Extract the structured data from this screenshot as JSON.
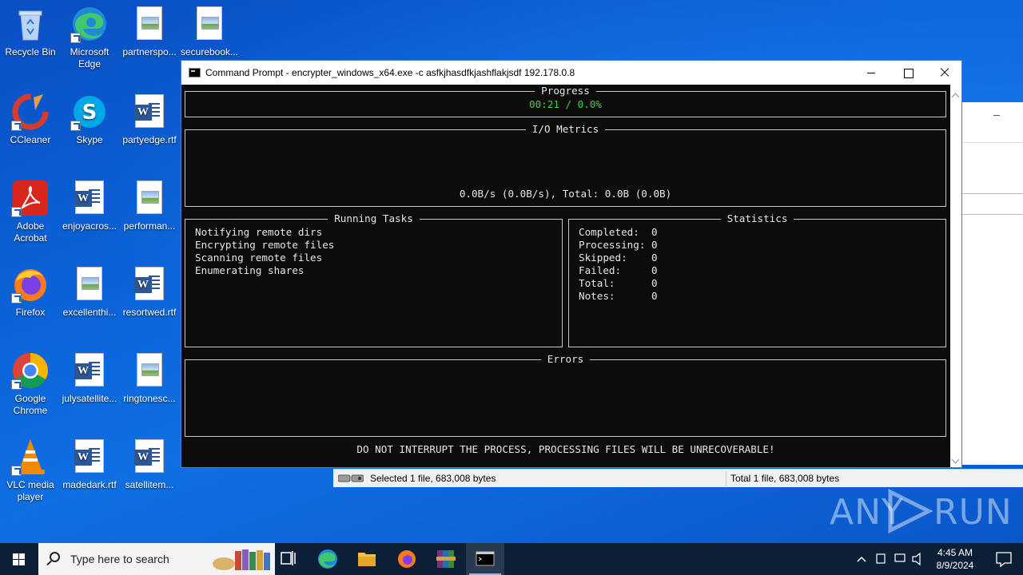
{
  "desktop": {
    "icons": [
      {
        "label": "Recycle Bin",
        "icon": "recycle-bin-icon"
      },
      {
        "label": "Microsoft Edge",
        "icon": "edge-icon"
      },
      {
        "label": "partnerspo...",
        "icon": "image-file-icon"
      },
      {
        "label": "securebook...",
        "icon": "image-file-icon"
      },
      {
        "label": "CCleaner",
        "icon": "ccleaner-icon"
      },
      {
        "label": "Skype",
        "icon": "skype-icon"
      },
      {
        "label": "partyedge.rtf",
        "icon": "word-file-icon"
      },
      {
        "label": "Adobe Acrobat",
        "icon": "acrobat-icon"
      },
      {
        "label": "enjoyacros...",
        "icon": "word-file-icon"
      },
      {
        "label": "performan...",
        "icon": "image-file-icon"
      },
      {
        "label": "Firefox",
        "icon": "firefox-icon"
      },
      {
        "label": "excellenthi...",
        "icon": "image-file-icon"
      },
      {
        "label": "resortwed.rtf",
        "icon": "word-file-icon"
      },
      {
        "label": "Google Chrome",
        "icon": "chrome-icon"
      },
      {
        "label": "julysatellite...",
        "icon": "word-file-icon"
      },
      {
        "label": "ringtonesc...",
        "icon": "image-file-icon"
      },
      {
        "label": "VLC media player",
        "icon": "vlc-icon"
      },
      {
        "label": "madedark.rtf",
        "icon": "word-file-icon"
      },
      {
        "label": "satellitem...",
        "icon": "word-file-icon"
      }
    ]
  },
  "explorer": {
    "status_selected": "Selected 1 file, 683,008 bytes",
    "status_total": "Total 1 file, 683,008 bytes"
  },
  "cmd": {
    "title": "Command Prompt - encrypter_windows_x64.exe  -c asfkjhasdfkjashflakjsdf 192.178.0.8",
    "progress_title": "Progress",
    "progress_value": "00:21 / 0.0%",
    "io_title": "I/O Metrics",
    "io_value": "0.0B/s (0.0B/s), Total: 0.0B (0.0B)",
    "tasks_title": "Running Tasks",
    "tasks": [
      "Notifying remote dirs",
      "Encrypting remote files",
      "Scanning remote files",
      "Enumerating shares"
    ],
    "stats_title": "Statistics",
    "stats": [
      "Completed:  0",
      "Processing: 0",
      "Skipped:    0",
      "Failed:     0",
      "Total:      0",
      "Notes:      0"
    ],
    "errors_title": "Errors",
    "warning": "DO NOT INTERRUPT THE PROCESS, PROCESSING FILES WILL BE UNRECOVERABLE!"
  },
  "watermark": {
    "left": "ANY",
    "right": "RUN"
  },
  "taskbar": {
    "search_placeholder": "Type here to search",
    "time": "4:45 AM",
    "date": "8/9/2024"
  },
  "colors": {
    "progress_green": "#3ed33e",
    "desktop_blue": "#0b63d9",
    "taskbar": "#0d1f36"
  }
}
